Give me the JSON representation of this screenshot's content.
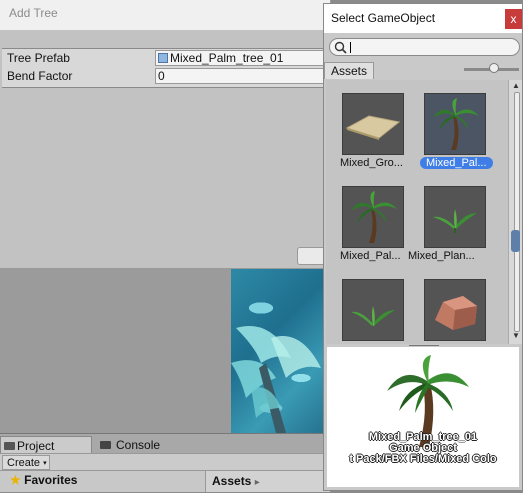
{
  "add_tree": {
    "title": "Add Tree",
    "properties": [
      {
        "label": "Tree Prefab",
        "value": "Mixed_Palm_tree_01",
        "icon": "prefab-cube-icon"
      },
      {
        "label": "Bend Factor",
        "value": "0"
      }
    ]
  },
  "select_gameobject": {
    "title": "Select GameObject",
    "close_label": "x",
    "search": {
      "value": "",
      "placeholder": ""
    },
    "tab_label": "Assets",
    "items": [
      {
        "label": "Mixed_Gro...",
        "kind": "ground",
        "selected": false
      },
      {
        "label": "Mixed_Pal...",
        "kind": "palm",
        "selected": true
      },
      {
        "label": "Mixed_Pal...",
        "kind": "palm",
        "selected": false
      },
      {
        "label": "Mixed_Plan...",
        "kind": "plant",
        "selected": false
      },
      {
        "label": "",
        "kind": "plant",
        "selected": false
      },
      {
        "label": "",
        "kind": "rock",
        "selected": false
      }
    ],
    "preview": {
      "name": "Mixed_Palm_tree_01",
      "type": "Game Object",
      "path": "t Pack/FBX Files/Mixed Colo"
    }
  },
  "bottom_tabs": [
    {
      "label": "Project",
      "icon": "folder-icon",
      "active": true
    },
    {
      "label": "Console",
      "icon": "console-icon",
      "active": false
    }
  ],
  "toolbar": {
    "create_label": "Create",
    "dropdown_icon": "chevron-down-icon"
  },
  "project_panel": {
    "favorites_label": "Favorites",
    "assets_breadcrumb": "Assets",
    "breadcrumb_arrow": "▸"
  },
  "colors": {
    "selection": "#3e7ee6",
    "close": "#c73b3b",
    "water": "#2d8aa6"
  }
}
